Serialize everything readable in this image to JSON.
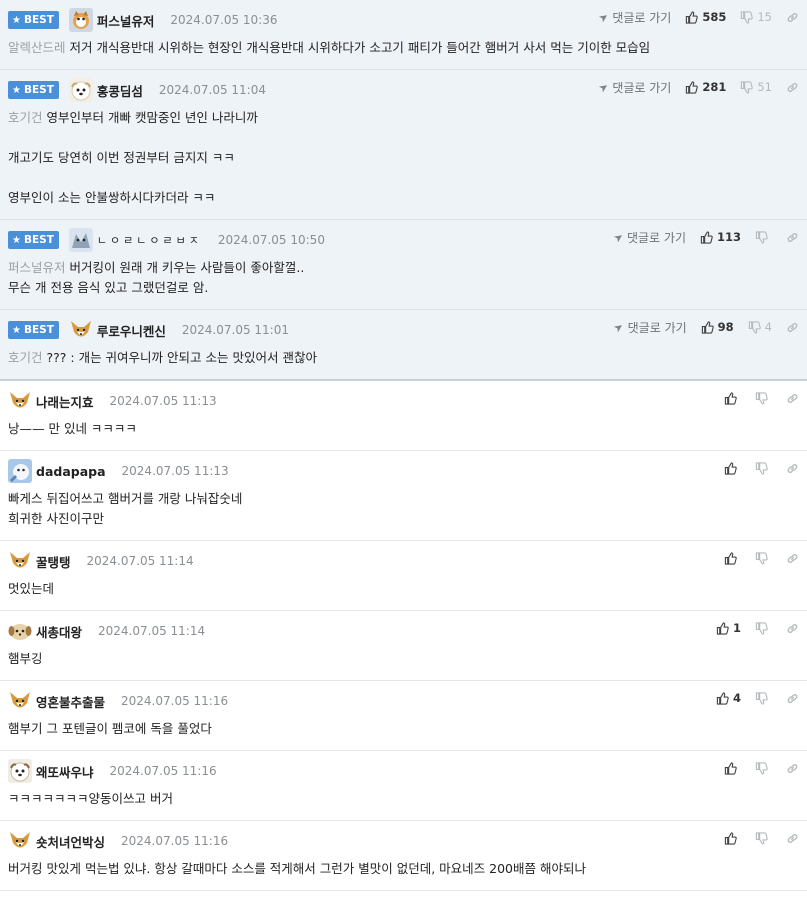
{
  "ui": {
    "best_label": "BEST",
    "reply_label": "댓글로 가기"
  },
  "colors": {
    "best_bg": "#eef3f8",
    "badge": "#4a90d9",
    "reference": "#9aa0a6"
  },
  "best_comments": [
    {
      "nick": "퍼스널유저",
      "date": "2024.07.05 10:36",
      "up": "585",
      "down": "15",
      "reference": "알렉산드레",
      "lines": [
        "저거 개식용반대 시위하는 현장인 개식용반대 시위하다가 소고기 패티가 들어간 햄버거 사서 먹는 기이한 모습임"
      ]
    },
    {
      "nick": "홍콩딤섬",
      "date": "2024.07.05 11:04",
      "up": "281",
      "down": "51",
      "reference": "호기건",
      "lines": [
        "영부인부터 개빠 캣맘중인 년인 나라니까",
        "",
        "개고기도 당연히 이번 정권부터 금지지 ㅋㅋ",
        "",
        "영부인이 소는 안불쌍하시다카더라 ㅋㅋ"
      ]
    },
    {
      "nick": "ㄴㅇㄹㄴㅇㄹㅂㅈ",
      "date": "2024.07.05 10:50",
      "up": "113",
      "down": "",
      "reference": "퍼스널유저",
      "lines": [
        "버거킹이 원래 개 키우는 사람들이 좋아할껄..",
        "무슨 개 전용 음식 있고 그랬던걸로 암."
      ]
    },
    {
      "nick": "루로우니켄신",
      "date": "2024.07.05 11:01",
      "up": "98",
      "down": "4",
      "reference": "호기건",
      "lines": [
        "??? : 개는 귀여우니까 안되고 소는 맛있어서 괜찮아"
      ]
    }
  ],
  "comments": [
    {
      "nick": "나래는지효",
      "date": "2024.07.05 11:13",
      "up": "",
      "lines": [
        "낭—— 만 있네 ㅋㅋㅋㅋ"
      ]
    },
    {
      "nick": "dadapapa",
      "date": "2024.07.05 11:13",
      "up": "",
      "lines": [
        "빠게스 뒤집어쓰고 햄버거를 개랑 나눠잡숫네",
        "희귀한 사진이구만"
      ]
    },
    {
      "nick": "꿀탱탱",
      "date": "2024.07.05 11:14",
      "up": "",
      "lines": [
        "멋있는데"
      ]
    },
    {
      "nick": "새총대왕",
      "date": "2024.07.05 11:14",
      "up": "1",
      "lines": [
        "햄부깅"
      ]
    },
    {
      "nick": "영혼불추출물",
      "date": "2024.07.05 11:16",
      "up": "4",
      "lines": [
        "햄부기 그 포텐글이 펨코에 독을 풀었다"
      ]
    },
    {
      "nick": "왜또싸우냐",
      "date": "2024.07.05 11:16",
      "up": "",
      "lines": [
        "ㅋㅋㅋㅋㅋㅋㅋ양동이쓰고 버거"
      ]
    },
    {
      "nick": "숏처녀언박싱",
      "date": "2024.07.05 11:16",
      "up": "",
      "lines": [
        "버거킹 맛있게 먹는법 있냐. 항상 갈때마다 소스를 적게해서 그런가 별맛이 없던데, 마요네즈 200배쯤 해야되나"
      ]
    }
  ]
}
